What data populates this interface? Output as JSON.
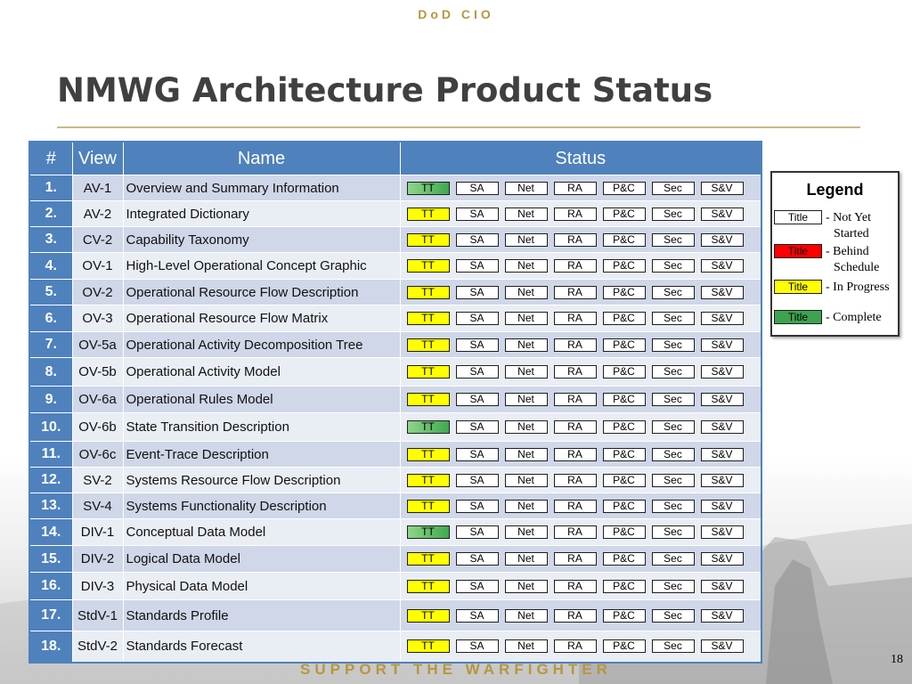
{
  "header": {
    "org": "DoD CIO"
  },
  "title": "NMWG Architecture Product Status",
  "table": {
    "columns": [
      "#",
      "View",
      "Name",
      "Status"
    ],
    "status_chips": [
      "TT",
      "SA",
      "Net",
      "RA",
      "P&C",
      "Sec",
      "S&V"
    ],
    "rows": [
      {
        "num": "1.",
        "view": "AV-1",
        "name": "Overview and Summary Information",
        "tt_status": "complete"
      },
      {
        "num": "2.",
        "view": "AV-2",
        "name": "Integrated Dictionary",
        "tt_status": "in-progress"
      },
      {
        "num": "3.",
        "view": "CV-2",
        "name": "Capability Taxonomy",
        "tt_status": "in-progress"
      },
      {
        "num": "4.",
        "view": "OV-1",
        "name": "High-Level Operational Concept Graphic",
        "tt_status": "in-progress"
      },
      {
        "num": "5.",
        "view": "OV-2",
        "name": "Operational Resource Flow Description",
        "tt_status": "in-progress"
      },
      {
        "num": "6.",
        "view": "OV-3",
        "name": "Operational Resource Flow Matrix",
        "tt_status": "in-progress"
      },
      {
        "num": "7.",
        "view": "OV-5a",
        "name": "Operational Activity Decomposition Tree",
        "tt_status": "in-progress"
      },
      {
        "num": "8.",
        "view": "OV-5b",
        "name": "Operational Activity Model",
        "tt_status": "in-progress"
      },
      {
        "num": "9.",
        "view": "OV-6a",
        "name": "Operational Rules Model",
        "tt_status": "in-progress"
      },
      {
        "num": "10.",
        "view": "OV-6b",
        "name": "State Transition Description",
        "tt_status": "complete"
      },
      {
        "num": "11.",
        "view": "OV-6c",
        "name": "Event-Trace Description",
        "tt_status": "in-progress"
      },
      {
        "num": "12.",
        "view": "SV-2",
        "name": "Systems Resource Flow Description",
        "tt_status": "in-progress"
      },
      {
        "num": "13.",
        "view": "SV-4",
        "name": "Systems Functionality Description",
        "tt_status": "in-progress"
      },
      {
        "num": "14.",
        "view": "DIV-1",
        "name": "Conceptual Data Model",
        "tt_status": "complete"
      },
      {
        "num": "15.",
        "view": "DIV-2",
        "name": "Logical Data Model",
        "tt_status": "in-progress"
      },
      {
        "num": "16.",
        "view": "DIV-3",
        "name": "Physical Data Model",
        "tt_status": "in-progress"
      },
      {
        "num": "17.",
        "view": "StdV-1",
        "name": "Standards Profile",
        "tt_status": "in-progress"
      },
      {
        "num": "18.",
        "view": "StdV-2",
        "name": "Standards Forecast",
        "tt_status": "in-progress"
      }
    ]
  },
  "legend": {
    "title": "Legend",
    "items": [
      {
        "swatch": "Title",
        "label": "- Not Yet Started",
        "color": "#ffffff"
      },
      {
        "swatch": "Title",
        "label": "- Behind Schedule",
        "color": "#ff0000"
      },
      {
        "swatch": "Title",
        "label": "- In Progress",
        "color": "#ffff00"
      },
      {
        "swatch": "Title",
        "label": "- Complete",
        "color": "#3da34f"
      }
    ]
  },
  "colors": {
    "header_blue": "#4f81bd",
    "row_band_dark": "#cfd7e8",
    "row_band_light": "#e9edf4",
    "gold": "#b8963e"
  },
  "footer": {
    "motto": "SUPPORT THE WARFIGHTER",
    "page_number": "18"
  }
}
